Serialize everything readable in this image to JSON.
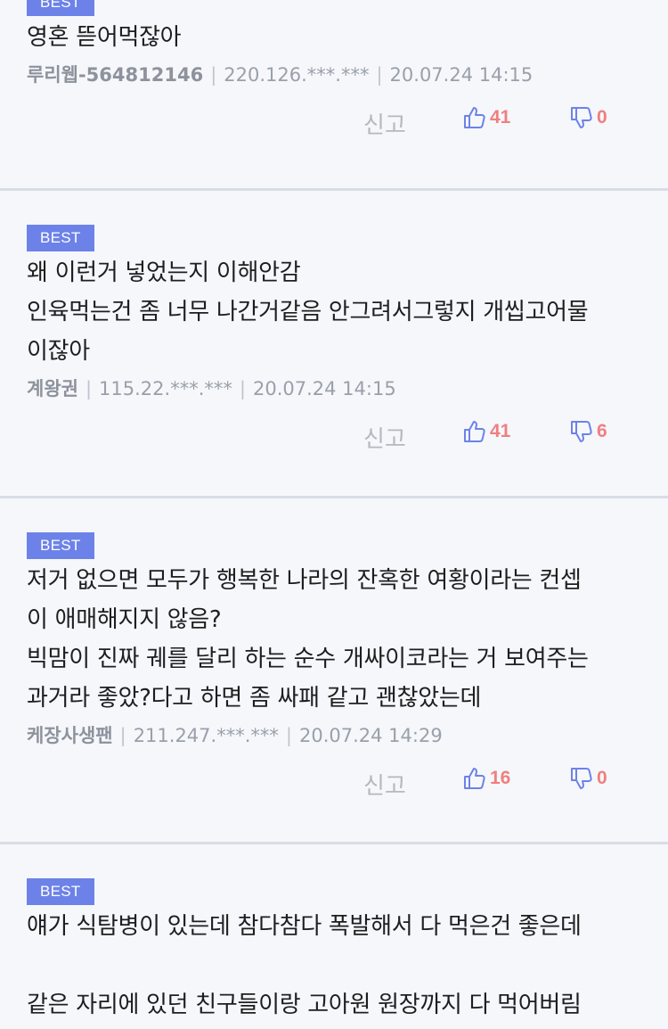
{
  "comments": [
    {
      "badge": "BEST",
      "lines": [
        "영혼 뜯어먹잖아"
      ],
      "author": "루리웹-564812146",
      "ip": "220.126.***.***",
      "date": "20.07.24 14:15",
      "report_label": "신고",
      "likes": "41",
      "dislikes": "0"
    },
    {
      "badge": "BEST",
      "lines": [
        "왜 이런거 넣었는지 이해안감",
        "인육먹는건 좀 너무 나간거같음 안그려서그렇지 개씹고어물",
        "이잖아"
      ],
      "author": "계왕권",
      "ip": "115.22.***.***",
      "date": "20.07.24 14:15",
      "report_label": "신고",
      "likes": "41",
      "dislikes": "6"
    },
    {
      "badge": "BEST",
      "lines": [
        "저거 없으면 모두가 행복한 나라의 잔혹한 여황이라는 컨셉",
        "이 애매해지지 않음?",
        "빅맘이 진짜 궤를 달리 하는 순수 개싸이코라는 거 보여주는",
        "과거라 좋았?다고 하면 좀 싸패 같고 괜찮았는데"
      ],
      "author": "케장사생팬",
      "ip": "211.247.***.***",
      "date": "20.07.24 14:29",
      "report_label": "신고",
      "likes": "16",
      "dislikes": "0"
    },
    {
      "badge": "BEST",
      "lines": [
        "얘가 식탐병이 있는데 참다참다 폭발해서 다 먹은건 좋은데",
        "",
        "같은 자리에 있던 친구들이랑 고아원 원장까지 다 먹어버림"
      ]
    }
  ],
  "colors": {
    "badge_bg": "#6d82e8",
    "vote_red": "#f07f7f",
    "icon_blue": "#6d82e8"
  },
  "icons": {
    "like": "thumbs-up-icon",
    "dislike": "thumbs-down-icon"
  }
}
